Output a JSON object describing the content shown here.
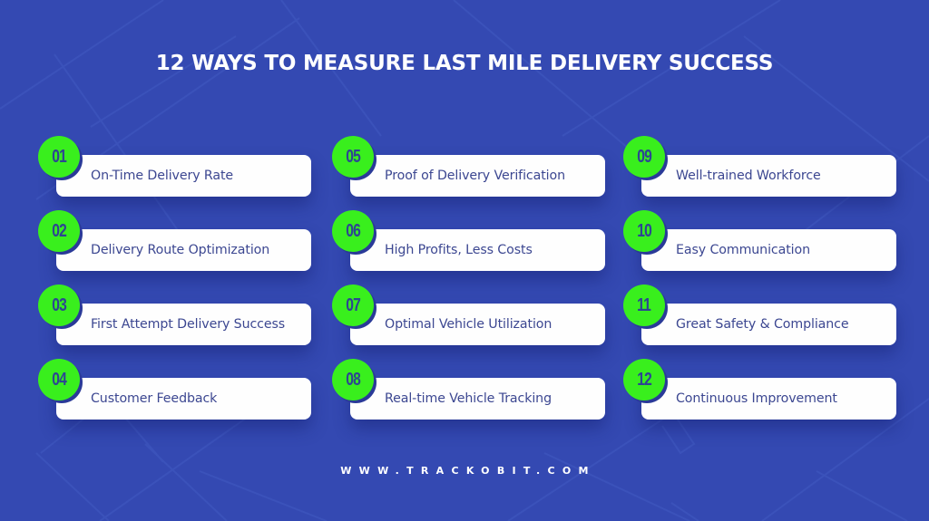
{
  "title": "12 WAYS TO MEASURE LAST MILE DELIVERY SUCCESS",
  "colors": {
    "background": "#3449b2",
    "badge": "#39ef1d",
    "badge_text": "#2d4592",
    "card": "#fefefe",
    "card_text": "#3c4791"
  },
  "items": [
    {
      "number": "01",
      "label": "On-Time Delivery Rate"
    },
    {
      "number": "02",
      "label": "Delivery Route Optimization"
    },
    {
      "number": "03",
      "label": "First Attempt Delivery Success"
    },
    {
      "number": "04",
      "label": "Customer Feedback"
    },
    {
      "number": "05",
      "label": "Proof of Delivery Verification"
    },
    {
      "number": "06",
      "label": "High Profits, Less Costs"
    },
    {
      "number": "07",
      "label": "Optimal Vehicle Utilization"
    },
    {
      "number": "08",
      "label": "Real-time Vehicle Tracking"
    },
    {
      "number": "09",
      "label": "Well-trained Workforce"
    },
    {
      "number": "10",
      "label": "Easy Communication"
    },
    {
      "number": "11",
      "label": "Great Safety & Compliance"
    },
    {
      "number": "12",
      "label": "Continuous Improvement"
    }
  ],
  "footer": "WWW.TRACKOBIT.COM"
}
